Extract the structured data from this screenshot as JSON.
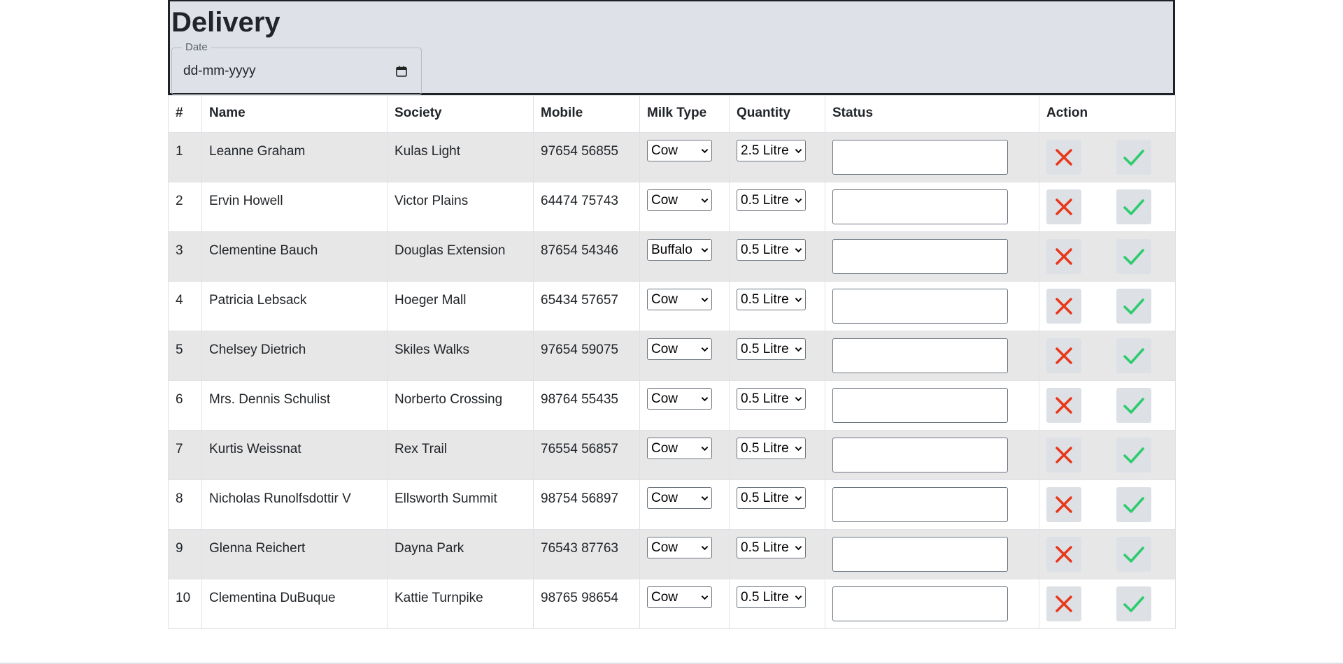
{
  "header": {
    "title": "Delivery",
    "date_label": "Date",
    "date_placeholder": "dd-mm-yyyy"
  },
  "table": {
    "columns": [
      "#",
      "Name",
      "Society",
      "Mobile",
      "Milk Type",
      "Quantity",
      "Status",
      "Action"
    ],
    "rows": [
      {
        "num": "1",
        "name": "Leanne Graham",
        "society": "Kulas Light",
        "mobile": "97654 56855",
        "milk": "Cow",
        "qty": "2.5 Litre",
        "status": ""
      },
      {
        "num": "2",
        "name": "Ervin Howell",
        "society": "Victor Plains",
        "mobile": "64474 75743",
        "milk": "Cow",
        "qty": "0.5 Litre",
        "status": ""
      },
      {
        "num": "3",
        "name": "Clementine Bauch",
        "society": "Douglas Extension",
        "mobile": "87654 54346",
        "milk": "Buffalo",
        "qty": "0.5 Litre",
        "status": ""
      },
      {
        "num": "4",
        "name": "Patricia Lebsack",
        "society": "Hoeger Mall",
        "mobile": "65434 57657",
        "milk": "Cow",
        "qty": "0.5 Litre",
        "status": ""
      },
      {
        "num": "5",
        "name": "Chelsey Dietrich",
        "society": "Skiles Walks",
        "mobile": "97654 59075",
        "milk": "Cow",
        "qty": "0.5 Litre",
        "status": ""
      },
      {
        "num": "6",
        "name": "Mrs. Dennis Schulist",
        "society": "Norberto Crossing",
        "mobile": "98764 55435",
        "milk": "Cow",
        "qty": "0.5 Litre",
        "status": ""
      },
      {
        "num": "7",
        "name": "Kurtis Weissnat",
        "society": "Rex Trail",
        "mobile": "76554 56857",
        "milk": "Cow",
        "qty": "0.5 Litre",
        "status": ""
      },
      {
        "num": "8",
        "name": "Nicholas Runolfsdottir V",
        "society": "Ellsworth Summit",
        "mobile": "98754 56897",
        "milk": "Cow",
        "qty": "0.5 Litre",
        "status": ""
      },
      {
        "num": "9",
        "name": "Glenna Reichert",
        "society": "Dayna Park",
        "mobile": "76543 87763",
        "milk": "Cow",
        "qty": "0.5 Litre",
        "status": ""
      },
      {
        "num": "10",
        "name": "Clementina DuBuque",
        "society": "Kattie Turnpike",
        "mobile": "98765 98654",
        "milk": "Cow",
        "qty": "0.5 Litre",
        "status": ""
      }
    ]
  },
  "icons": {
    "reject": "close-icon",
    "accept": "check-icon",
    "date": "calendar-icon",
    "dropdown": "chevron-down-icon"
  },
  "colors": {
    "reject": "#e8381b",
    "accept": "#2ecc6e",
    "header_bg": "#dee2e8",
    "stripe": "#e7e7e8"
  }
}
